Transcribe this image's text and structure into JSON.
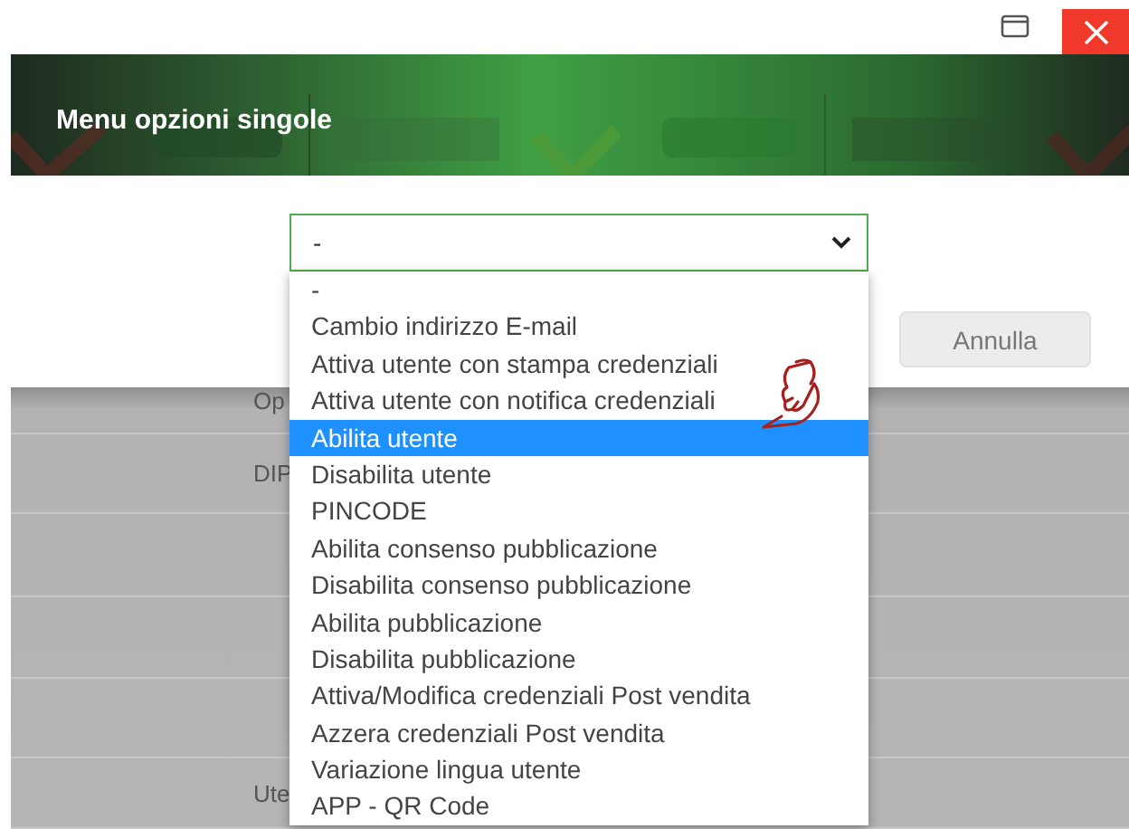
{
  "window": {
    "title": "Menu opzioni singole"
  },
  "select": {
    "value": "-",
    "expanded": true
  },
  "options": [
    {
      "label": "-",
      "selected": false
    },
    {
      "label": "Cambio indirizzo E-mail",
      "selected": false
    },
    {
      "label": "Attiva utente con stampa credenziali",
      "selected": false
    },
    {
      "label": "Attiva utente con notifica credenziali",
      "selected": false
    },
    {
      "label": "Abilita utente",
      "selected": true
    },
    {
      "label": "Disabilita utente",
      "selected": false
    },
    {
      "label": "PINCODE",
      "selected": false
    },
    {
      "label": "Abilita consenso pubblicazione",
      "selected": false
    },
    {
      "label": "Disabilita consenso pubblicazione",
      "selected": false
    },
    {
      "label": "Abilita pubblicazione",
      "selected": false
    },
    {
      "label": "Disabilita pubblicazione",
      "selected": false
    },
    {
      "label": "Attiva/Modifica credenziali Post vendita",
      "selected": false
    },
    {
      "label": "Azzera credenziali Post vendita",
      "selected": false
    },
    {
      "label": "Variazione lingua utente",
      "selected": false
    },
    {
      "label": "APP - QR Code",
      "selected": false
    }
  ],
  "buttons": [
    "Annulla"
  ],
  "rows": [
    {
      "label": "Op"
    },
    {
      "label": "DIP"
    },
    {},
    {},
    {},
    {
      "label": "Ute"
    }
  ]
}
